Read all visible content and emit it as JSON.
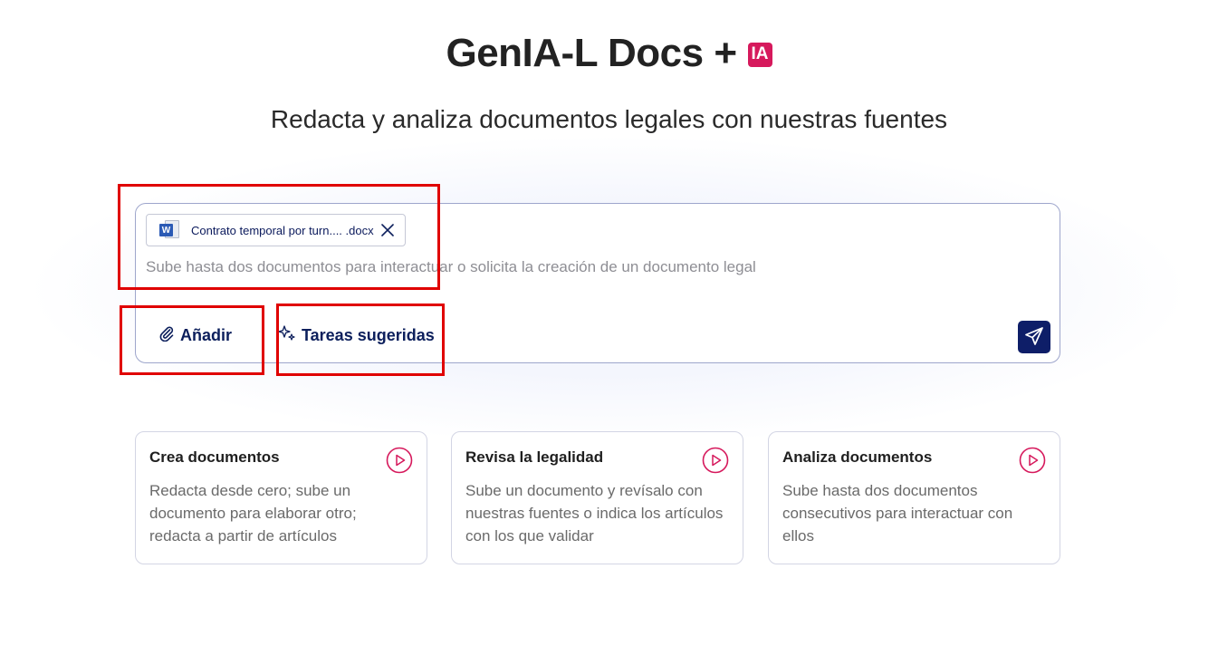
{
  "header": {
    "title": "GenIA-L Docs +",
    "badge": "IA",
    "subtitle": "Redacta y analiza documentos legales con nuestras fuentes"
  },
  "composer": {
    "attachment": {
      "icon": "word-document-icon",
      "icon_letter": "W",
      "file_name": "Contrato temporal por turn.... .docx"
    },
    "placeholder": "Sube hasta dos documentos para interactuar o solicita la creación de un documento legal",
    "value": "",
    "add_label": "Añadir",
    "tasks_label": "Tareas sugeridas",
    "send_icon": "send-paper-plane-icon"
  },
  "cards": [
    {
      "title": "Crea documentos",
      "description": "Redacta desde cero; sube un documento para elaborar otro; redacta a partir de artículos"
    },
    {
      "title": "Revisa la legalidad",
      "description": "Sube un documento y revísalo con nuestras fuentes o indica los artículos con los que validar"
    },
    {
      "title": "Analiza documentos",
      "description": "Sube hasta dos documentos consecutivos para interactuar con ellos"
    }
  ],
  "colors": {
    "accent_navy": "#0e1e68",
    "brand_pink": "#d6195c",
    "highlight_red": "#e00000",
    "border": "#9ea6cc"
  }
}
